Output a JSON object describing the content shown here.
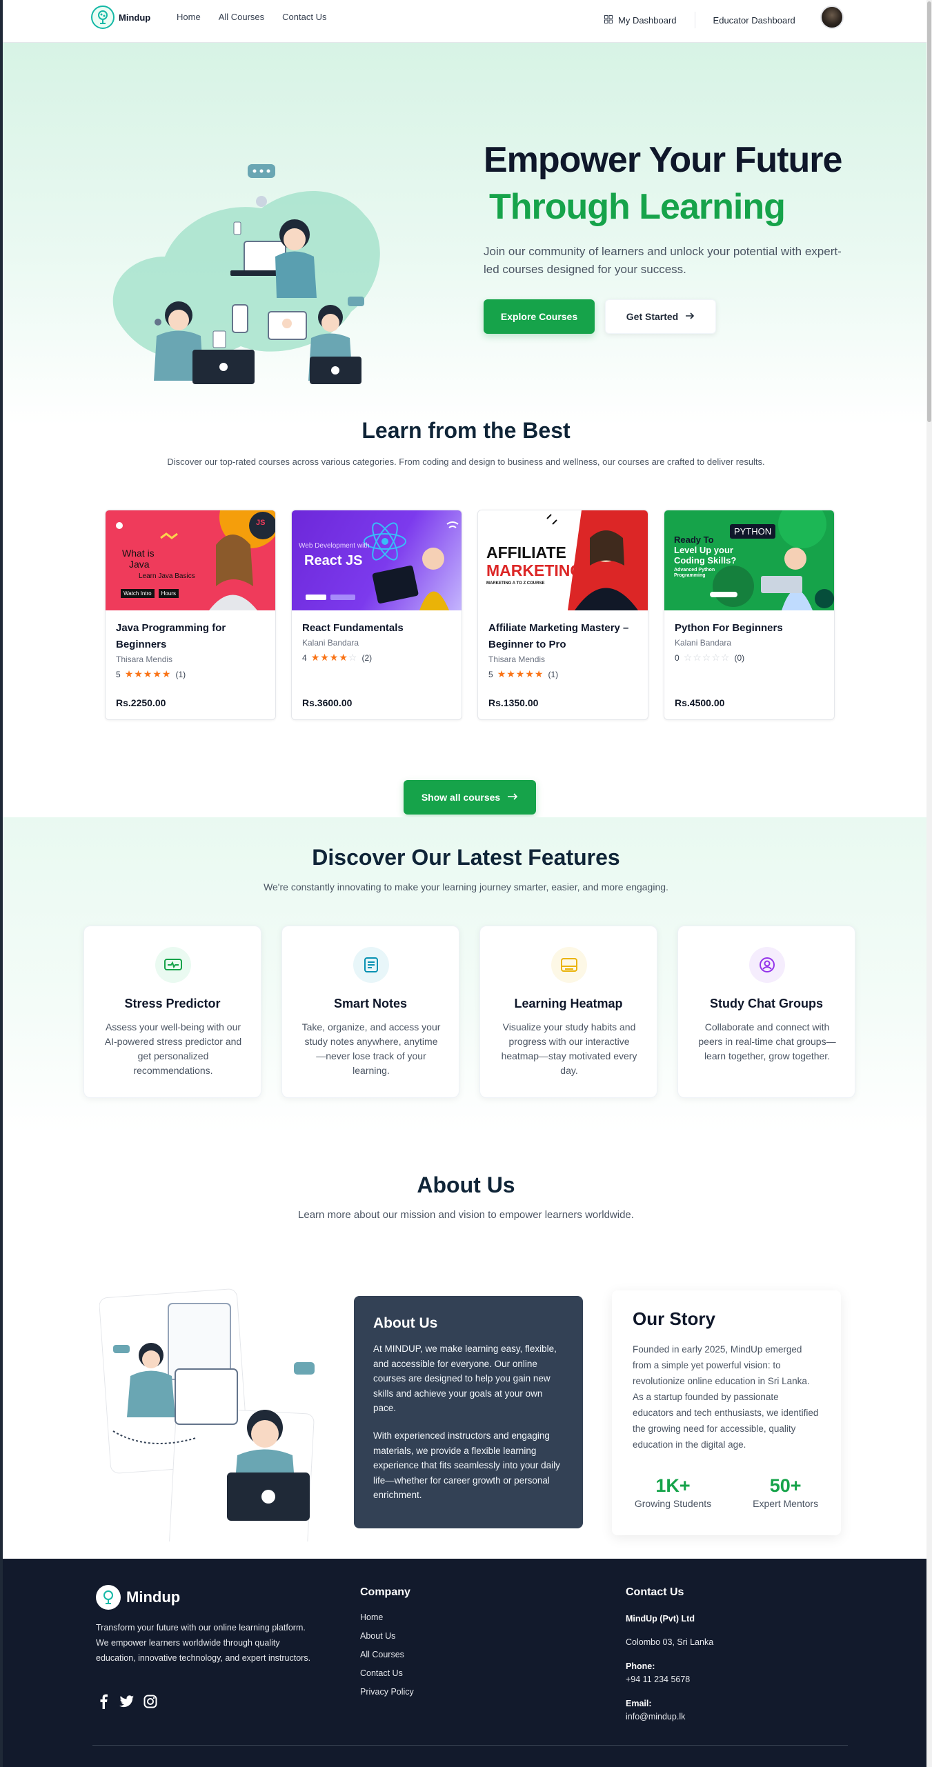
{
  "nav": {
    "logo_text": "Mindup",
    "links": [
      "Home",
      "All Courses",
      "Contact Us"
    ],
    "my_dashboard": "My Dashboard",
    "educator_dashboard": "Educator Dashboard"
  },
  "hero": {
    "title_line1": "Empower Your Future",
    "title_line2": "Through Learning",
    "subtitle": "Join our community of learners and unlock your potential with expert-led courses designed for your success.",
    "primary_button": "Explore Courses",
    "secondary_button": "Get Started"
  },
  "courses": {
    "title": "Learn from the Best",
    "subtitle": "Discover our top-rated courses across various categories. From coding and design to business and wellness, our courses are crafted to deliver results.",
    "items": [
      {
        "title": "Java Programming for Beginners",
        "instructor": "Thisara Mendis",
        "rating": "5",
        "stars": 5,
        "reviews": "(1)",
        "price": "Rs.2250.00",
        "thumb": {
          "line1": "What is",
          "line2": "Java",
          "line3": "Learn Java Basics",
          "tag1": "Watch Intro",
          "tag2": "Hours",
          "badge": "JS"
        }
      },
      {
        "title": "React Fundamentals",
        "instructor": "Kalani Bandara",
        "rating": "4",
        "stars": 4,
        "reviews": "(2)",
        "price": "Rs.3600.00",
        "thumb": {
          "line1": "Web Development with",
          "line2": "React JS"
        }
      },
      {
        "title": "Affiliate Marketing Mastery – Beginner to Pro",
        "instructor": "Thisara Mendis",
        "rating": "5",
        "stars": 5,
        "reviews": "(1)",
        "price": "Rs.1350.00",
        "thumb": {
          "line1": "AFFILIATE",
          "line2": "MARKETING",
          "line3": "MARKETING A TO Z COURSE"
        }
      },
      {
        "title": "Python For Beginners",
        "instructor": "Kalani Bandara",
        "rating": "0",
        "stars": 0,
        "reviews": "(0)",
        "price": "Rs.4500.00",
        "thumb": {
          "line1": "Ready To",
          "line2": "Level Up your",
          "line3": "Coding Skills?",
          "line4": "Advanced Python Programming",
          "badge": "PYTHON"
        }
      }
    ],
    "show_all_button": "Show all courses"
  },
  "features": {
    "title": "Discover Our Latest Features",
    "subtitle": "We're constantly innovating to make your learning journey smarter, easier, and more engaging.",
    "items": [
      {
        "title": "Stress Predictor",
        "desc": "Assess your well-being with our AI-powered stress predictor and get personalized recommendations.",
        "icon": "monitor-heart-icon",
        "color": "#16a34a",
        "bg": "#eafaf1"
      },
      {
        "title": "Smart Notes",
        "desc": "Take, organize, and access your study notes anywhere, anytime—never lose track of your learning.",
        "icon": "notes-icon",
        "color": "#0891b2",
        "bg": "#e8f6f9"
      },
      {
        "title": "Learning Heatmap",
        "desc": "Visualize your study habits and progress with our interactive heatmap—stay motivated every day.",
        "icon": "heatmap-icon",
        "color": "#eab308",
        "bg": "#fdf8e6"
      },
      {
        "title": "Study Chat Groups",
        "desc": "Collaborate and connect with peers in real-time chat groups—learn together, grow together.",
        "icon": "chat-group-icon",
        "color": "#9333ea",
        "bg": "#f5edfd"
      }
    ]
  },
  "about": {
    "title": "About Us",
    "subtitle": "Learn more about our mission and vision to empower learners worldwide.",
    "card_title": "About Us",
    "card_p1": "At MINDUP, we make learning easy, flexible, and accessible for everyone. Our online courses are designed to help you gain new skills and achieve your goals at your own pace.",
    "card_p2": "With experienced instructors and engaging materials, we provide a flexible learning experience that fits seamlessly into your daily life—whether for career growth or personal enrichment.",
    "story_title": "Our Story",
    "story_text": "Founded in early 2025, MindUp emerged from a simple yet powerful vision: to revolutionize online education in Sri Lanka. As a startup founded by passionate educators and tech enthusiasts, we identified the growing need for accessible, quality education in the digital age.",
    "stat1_num": "1K+",
    "stat1_label": "Growing Students",
    "stat2_num": "50+",
    "stat2_label": "Expert Mentors"
  },
  "footer": {
    "logo_text": "Mindup",
    "desc": "Transform your future with our online learning platform. We empower learners worldwide through quality education, innovative technology, and expert instructors.",
    "company_title": "Company",
    "company_links": [
      "Home",
      "About Us",
      "All Courses",
      "Contact Us",
      "Privacy Policy"
    ],
    "contact_title": "Contact Us",
    "company_name": "MindUp (Pvt) Ltd",
    "address": "Colombo 03, Sri Lanka",
    "phone_label": "Phone:",
    "phone": "+94 11 234 5678",
    "email_label": "Email:",
    "email": "info@mindup.lk"
  },
  "colors": {
    "accent": "#16a34a",
    "dark_card": "#334155",
    "footer_bg": "#121a2c",
    "star": "#f97316"
  }
}
